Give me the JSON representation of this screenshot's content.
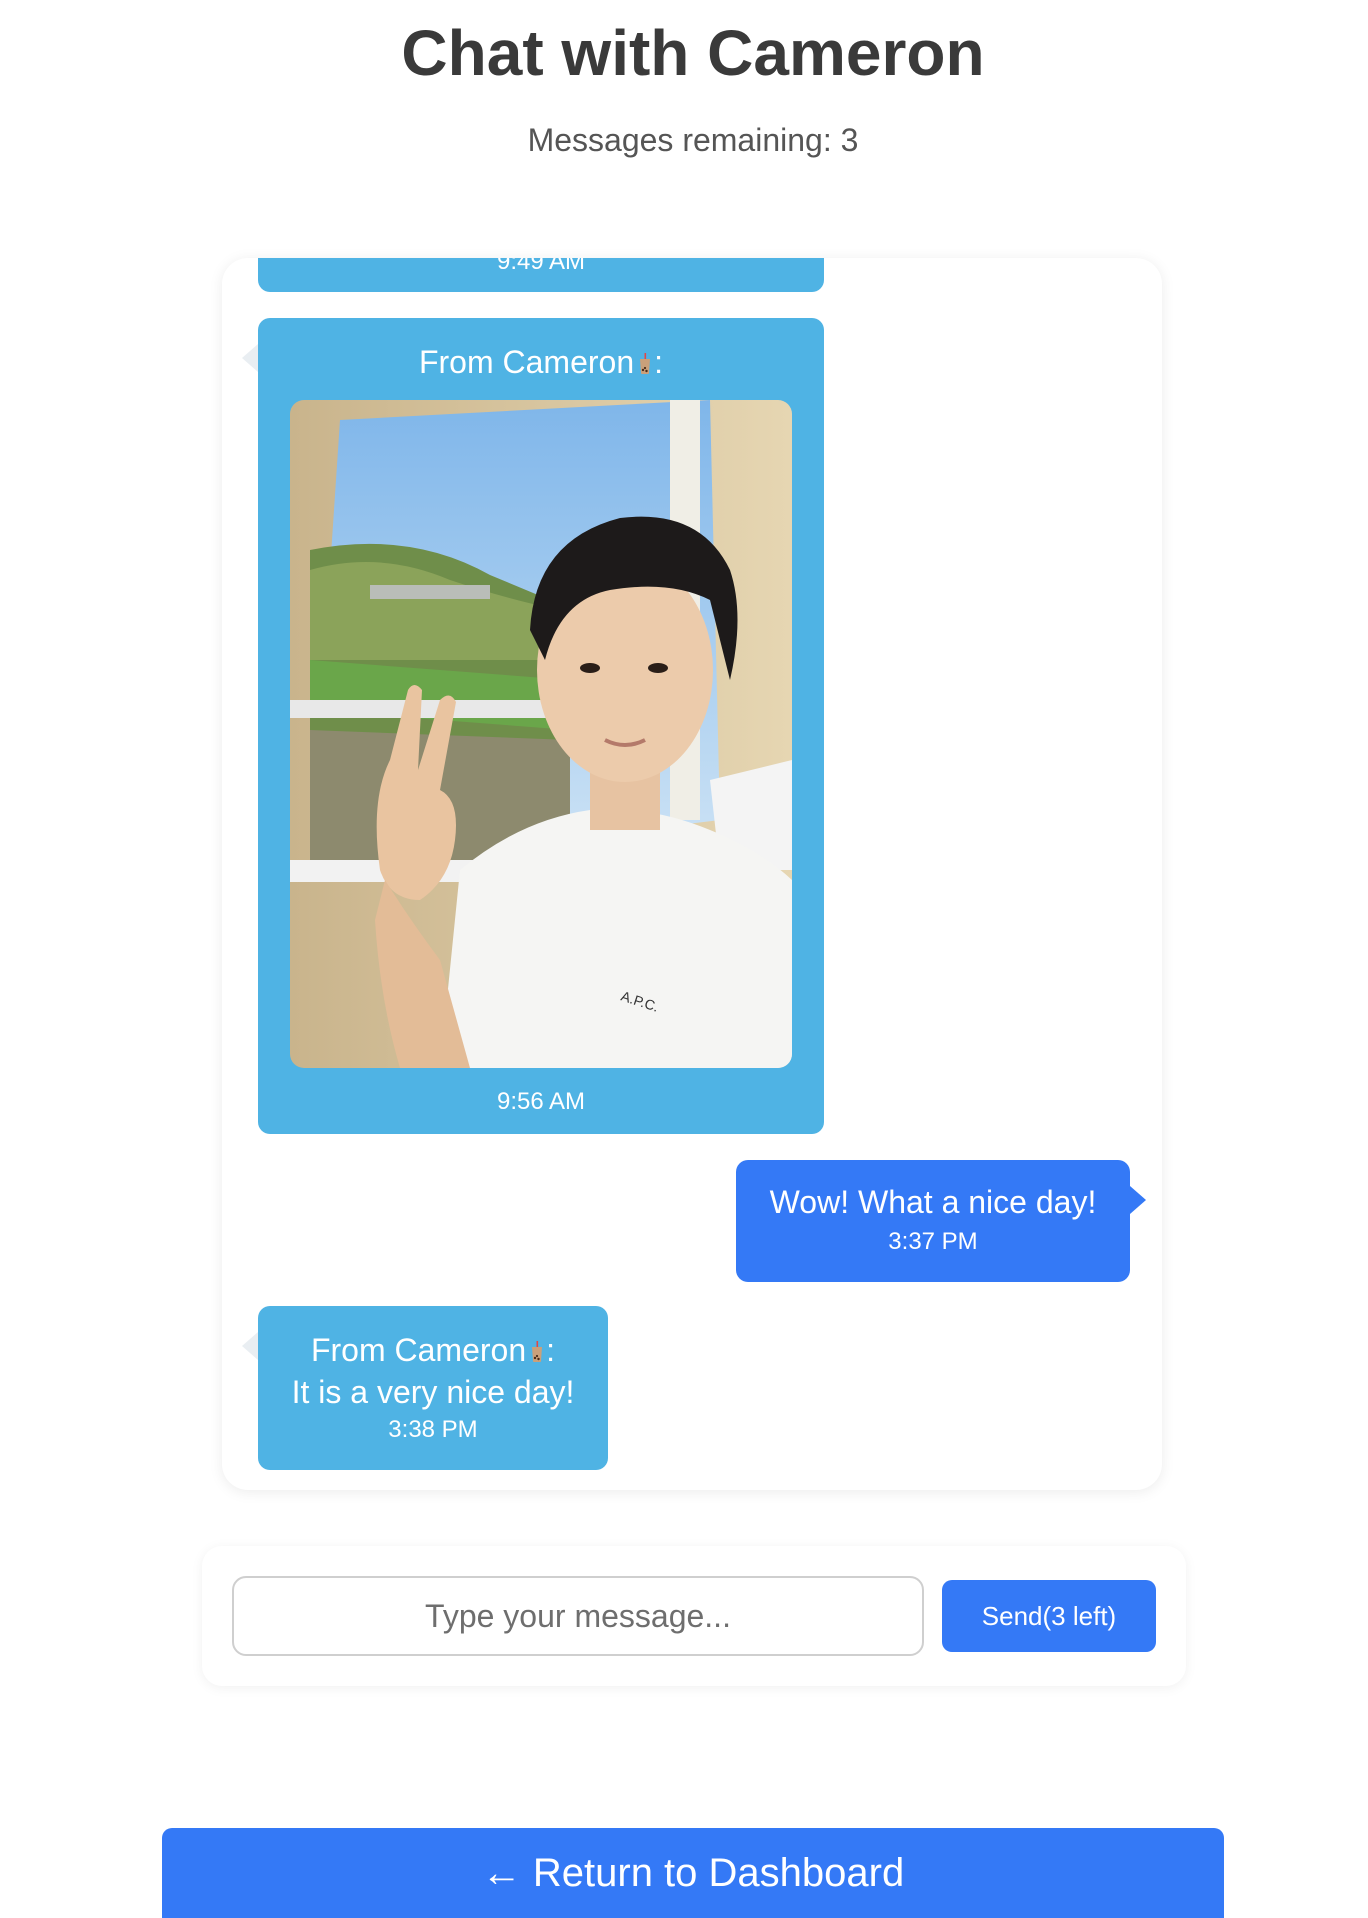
{
  "page": {
    "title": "Chat with Cameron",
    "remaining_text": "Messages remaining: 3"
  },
  "colors": {
    "incoming_bubble": "#4fb3e4",
    "outgoing_bubble": "#3479f6",
    "accent": "#3479f6"
  },
  "messages": [
    {
      "direction": "incoming",
      "time": "9:49 AM",
      "partially_visible": true
    },
    {
      "direction": "incoming",
      "sender": "From Cameron",
      "sender_icon": "bubble-tea-icon",
      "sender_suffix": ":",
      "photo": "selfie-photo",
      "time": "9:56 AM"
    },
    {
      "direction": "outgoing",
      "text": "Wow! What a nice day!",
      "time": "3:37 PM"
    },
    {
      "direction": "incoming",
      "sender": "From Cameron",
      "sender_icon": "bubble-tea-icon",
      "sender_suffix": ":",
      "text": "It is a very nice day!",
      "time": "3:38 PM"
    }
  ],
  "composer": {
    "placeholder": "Type your message...",
    "value": "",
    "send_label": "Send(3 left)"
  },
  "footer": {
    "return_label": "← Return to Dashboard"
  }
}
